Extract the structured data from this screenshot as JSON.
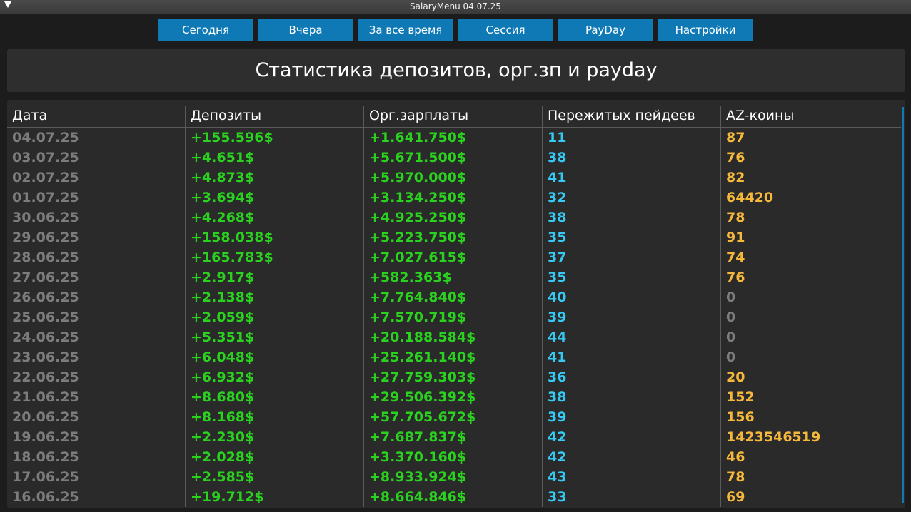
{
  "window": {
    "title": "SalaryMenu 04.07.25"
  },
  "icons": {
    "collapse": "triangle-down-icon"
  },
  "colors": {
    "accent": "#0f79b6",
    "date": "#7c7c7c",
    "money": "#2ad11e",
    "paydays": "#35c9f3",
    "coins": "#f6b83a"
  },
  "tabs": [
    {
      "label": "Сегодня"
    },
    {
      "label": "Вчера"
    },
    {
      "label": "За все время"
    },
    {
      "label": "Сессия"
    },
    {
      "label": "PayDay"
    },
    {
      "label": "Настройки"
    }
  ],
  "page": {
    "title": "Статистика депозитов, орг.зп и payday"
  },
  "table": {
    "columns": [
      "Дата",
      "Депозиты",
      "Орг.зарплаты",
      "Пережитых пейдеев",
      "AZ-коины"
    ],
    "rows": [
      [
        "04.07.25",
        "+155.596$",
        "+1.641.750$",
        "11",
        "87"
      ],
      [
        "03.07.25",
        "+4.651$",
        "+5.671.500$",
        "38",
        "76"
      ],
      [
        "02.07.25",
        "+4.873$",
        "+5.970.000$",
        "41",
        "82"
      ],
      [
        "01.07.25",
        "+3.694$",
        "+3.134.250$",
        "32",
        "64420"
      ],
      [
        "30.06.25",
        "+4.268$",
        "+4.925.250$",
        "38",
        "78"
      ],
      [
        "29.06.25",
        "+158.038$",
        "+5.223.750$",
        "35",
        "91"
      ],
      [
        "28.06.25",
        "+165.783$",
        "+7.027.615$",
        "37",
        "74"
      ],
      [
        "27.06.25",
        "+2.917$",
        "+582.363$",
        "35",
        "76"
      ],
      [
        "26.06.25",
        "+2.138$",
        "+7.764.840$",
        "40",
        "0"
      ],
      [
        "25.06.25",
        "+2.059$",
        "+7.570.719$",
        "39",
        "0"
      ],
      [
        "24.06.25",
        "+5.351$",
        "+20.188.584$",
        "44",
        "0"
      ],
      [
        "23.06.25",
        "+6.048$",
        "+25.261.140$",
        "41",
        "0"
      ],
      [
        "22.06.25",
        "+6.932$",
        "+27.759.303$",
        "36",
        "20"
      ],
      [
        "21.06.25",
        "+8.680$",
        "+29.506.392$",
        "38",
        "152"
      ],
      [
        "20.06.25",
        "+8.168$",
        "+57.705.672$",
        "39",
        "156"
      ],
      [
        "19.06.25",
        "+2.230$",
        "+7.687.837$",
        "42",
        "1423546519"
      ],
      [
        "18.06.25",
        "+2.028$",
        "+3.370.160$",
        "42",
        "46"
      ],
      [
        "17.06.25",
        "+2.585$",
        "+8.933.924$",
        "43",
        "78"
      ],
      [
        "16.06.25",
        "+19.712$",
        "+8.664.846$",
        "33",
        "69"
      ]
    ]
  }
}
